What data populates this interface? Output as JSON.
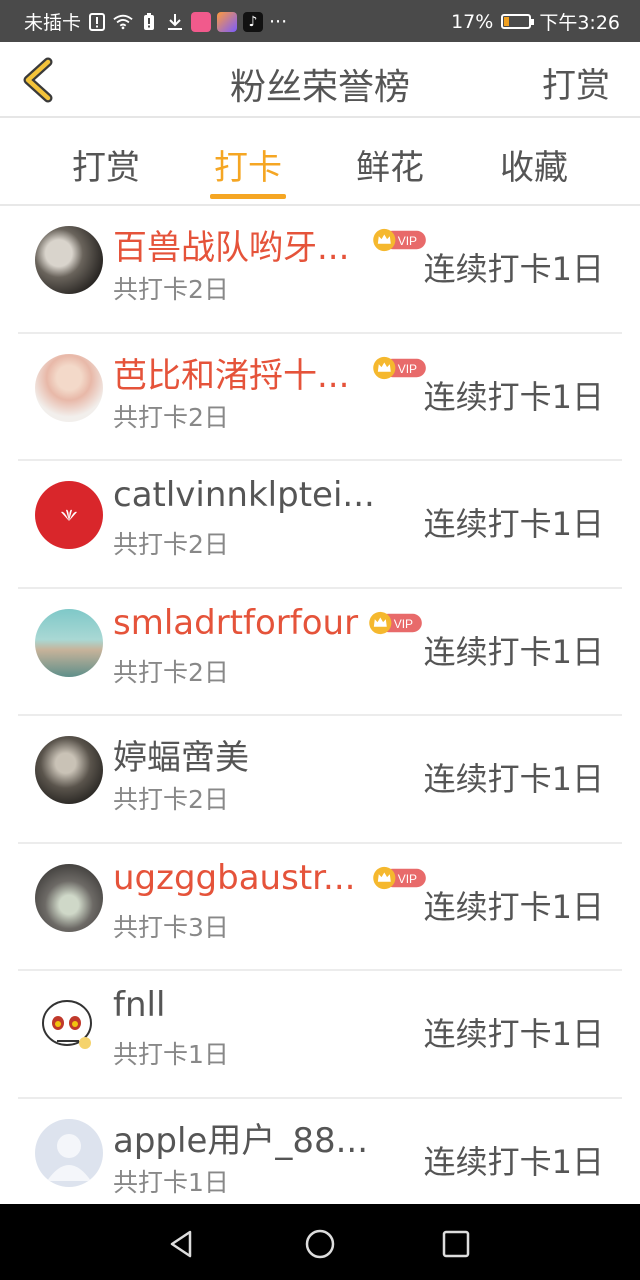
{
  "status_bar": {
    "carrier": "未插卡",
    "battery": "17%",
    "time": "下午3:26",
    "more": "···"
  },
  "header": {
    "title": "粉丝荣誉榜",
    "right_action": "打赏"
  },
  "tabs": [
    {
      "label": "打赏",
      "active": false
    },
    {
      "label": "打卡",
      "active": true
    },
    {
      "label": "鲜花",
      "active": false
    },
    {
      "label": "收藏",
      "active": false
    }
  ],
  "vip_label": "VIP",
  "colors": {
    "accent": "#f5a623",
    "vip_name": "#e5533a",
    "vip_badge": "#e86a6a"
  },
  "fans": [
    {
      "name": "百兽战队哟牙...",
      "vip": true,
      "total": "共打卡2日",
      "streak": "连续打卡1日"
    },
    {
      "name": "芭比和渚捋十...",
      "vip": true,
      "total": "共打卡2日",
      "streak": "连续打卡1日"
    },
    {
      "name": "catlvinnklptei...",
      "vip": false,
      "total": "共打卡2日",
      "streak": "连续打卡1日"
    },
    {
      "name": "smladrtforfour",
      "vip": true,
      "total": "共打卡2日",
      "streak": "连续打卡1日"
    },
    {
      "name": "婷蝠啻美",
      "vip": false,
      "total": "共打卡2日",
      "streak": "连续打卡1日"
    },
    {
      "name": "ugzggbaustr...",
      "vip": true,
      "total": "共打卡3日",
      "streak": "连续打卡1日"
    },
    {
      "name": "fnll",
      "vip": false,
      "total": "共打卡1日",
      "streak": "连续打卡1日"
    },
    {
      "name": "apple用户_88...",
      "vip": false,
      "total": "共打卡1日",
      "streak": "连续打卡1日"
    }
  ]
}
